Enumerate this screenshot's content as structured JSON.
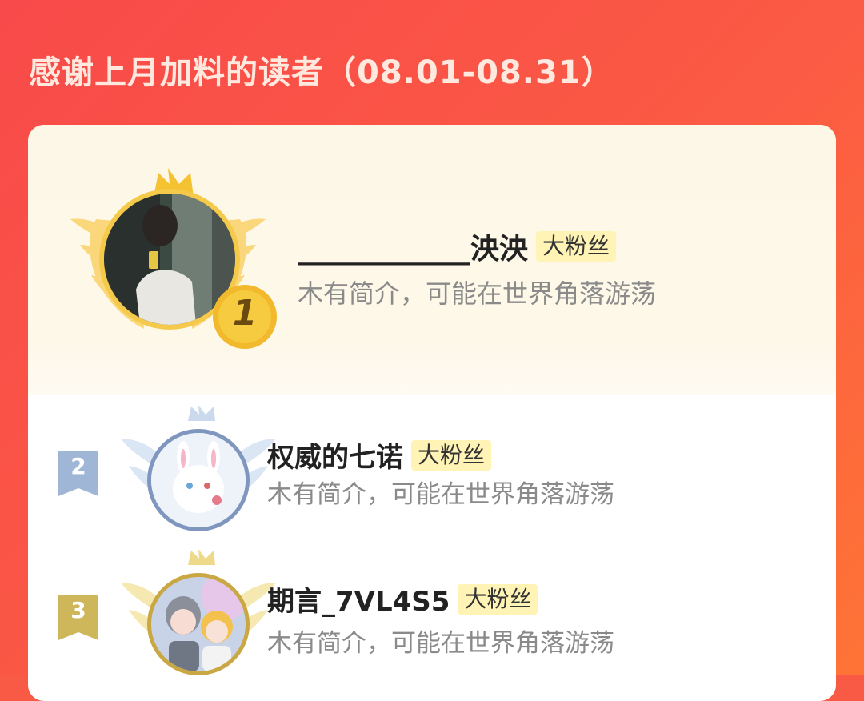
{
  "header": {
    "title": "感谢上月加料的读者（08.01-08.31）"
  },
  "readers": [
    {
      "rank": "1",
      "name": "____________泱泱",
      "tag": "大粉丝",
      "bio": "木有简介，可能在世界角落游荡"
    },
    {
      "rank": "2",
      "name": "权威的七诺",
      "tag": "大粉丝",
      "bio": "木有简介，可能在世界角落游荡"
    },
    {
      "rank": "3",
      "name": "期言_7VL4S5",
      "tag": "大粉丝",
      "bio": "木有简介，可能在世界角落游荡"
    }
  ],
  "colors": {
    "background": "#f85a45",
    "gold": "#f5c332",
    "silver": "#8aa4c8",
    "bronze": "#c9a843",
    "tag_bg": "#fff3b5"
  },
  "icons": [
    "crown-icon",
    "wings-icon",
    "medal-icon",
    "rank-ribbon-icon"
  ]
}
